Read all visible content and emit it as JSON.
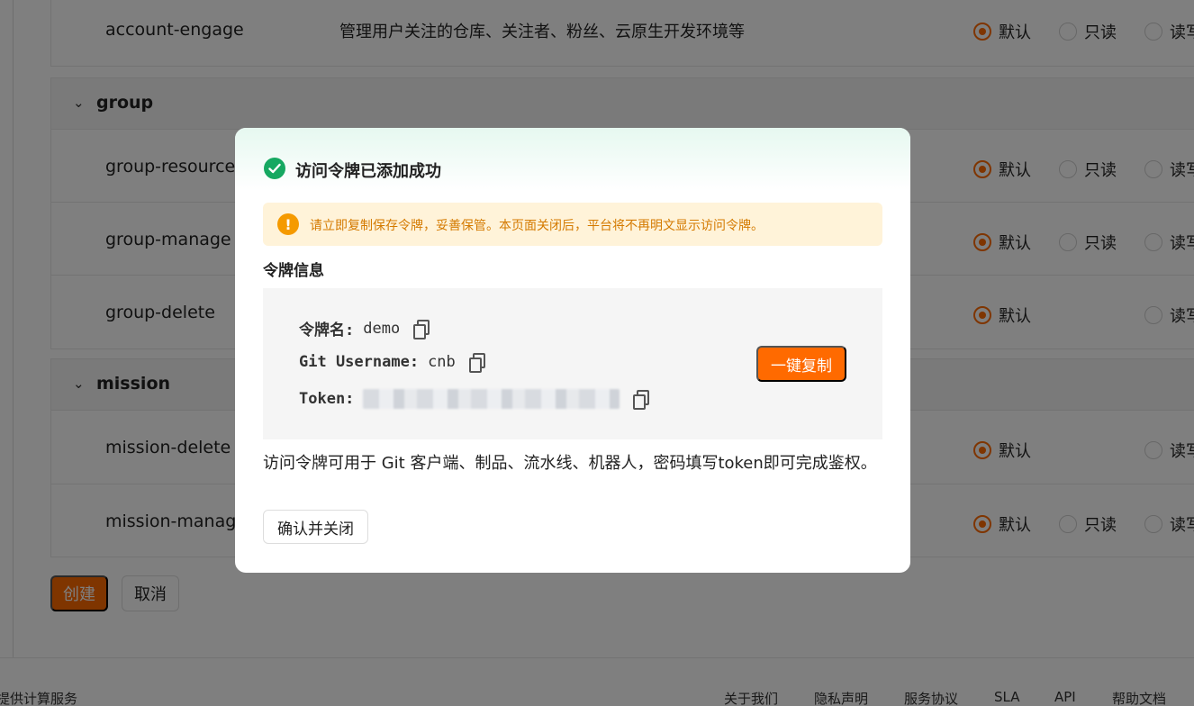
{
  "rows": {
    "account_engage": {
      "name": "account-engage",
      "desc": "管理用户关注的仓库、关注者、粉丝、云原生开发环境等"
    },
    "group_resource": {
      "name": "group-resource"
    },
    "group_manage": {
      "name": "group-manage"
    },
    "group_delete": {
      "name": "group-delete"
    },
    "mission_delete": {
      "name": "mission-delete"
    },
    "mission_manage": {
      "name": "mission-manage"
    }
  },
  "groups": {
    "group": "group",
    "mission": "mission"
  },
  "radio_labels": {
    "default": "默认",
    "readonly": "只读",
    "readwrite": "读写"
  },
  "form_buttons": {
    "create": "创建",
    "cancel": "取消"
  },
  "footer": {
    "left": "提供计算服务",
    "links": [
      "关于我们",
      "隐私声明",
      "服务协议",
      "SLA",
      "API",
      "帮助文档"
    ]
  },
  "modal": {
    "title": "访问令牌已添加成功",
    "warning": "请立即复制保存令牌，妥善保管。本页面关闭后，平台将不再明文显示访问令牌。",
    "section_title": "令牌信息",
    "token_name_label": "令牌名:",
    "token_name_value": "demo",
    "git_username_label": "Git Username:",
    "git_username_value": "cnb",
    "token_label": "Token:",
    "copy_all_label": "一键复制",
    "help_text": "访问令牌可用于 Git 客户端、制品、流水线、机器人，密码填写token即可完成鉴权。",
    "confirm_label": "确认并关闭"
  },
  "colors": {
    "accent": "#ff6a00",
    "success": "#16a861",
    "warning": "#f59a00"
  }
}
